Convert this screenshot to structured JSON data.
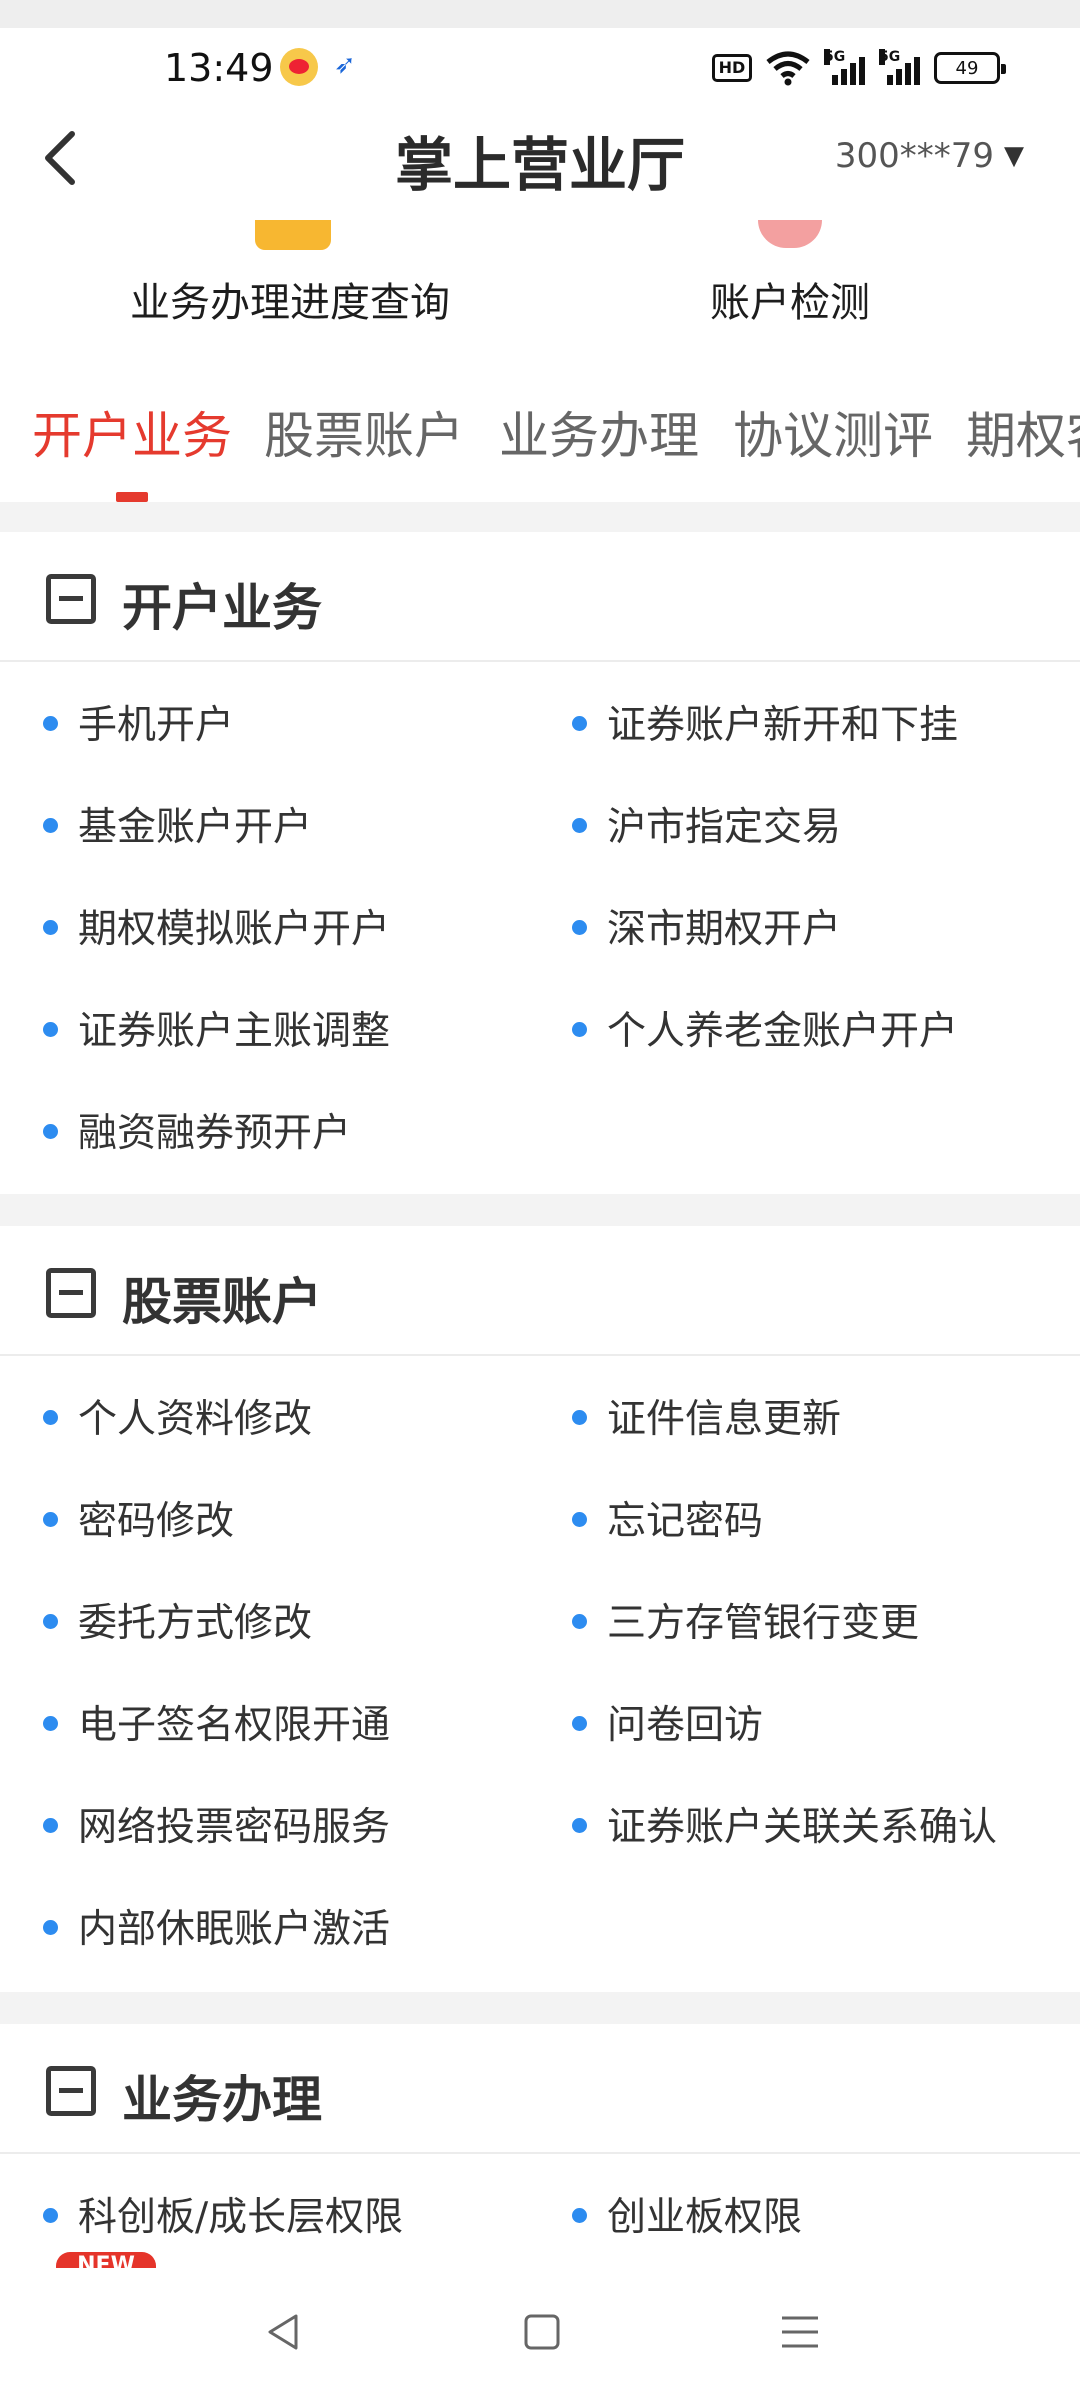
{
  "status_bar": {
    "time": "13:49",
    "hd": "HD",
    "network_1": "5G",
    "network_2": "5G",
    "battery": "49"
  },
  "header": {
    "title": "掌上营业厅",
    "account": "300***79"
  },
  "quick_actions": [
    {
      "label": "业务办理进度查询"
    },
    {
      "label": "账户检测"
    }
  ],
  "tabs": [
    {
      "label": "开户业务"
    },
    {
      "label": "股票账户"
    },
    {
      "label": "业务办理"
    },
    {
      "label": "协议测评"
    },
    {
      "label": "期权客"
    }
  ],
  "sections": [
    {
      "title": "开户业务",
      "items": [
        {
          "label": "手机开户"
        },
        {
          "label": "证券账户新开和下挂"
        },
        {
          "label": "基金账户开户"
        },
        {
          "label": "沪市指定交易"
        },
        {
          "label": "期权模拟账户开户"
        },
        {
          "label": "深市期权开户"
        },
        {
          "label": "证券账户主账调整"
        },
        {
          "label": "个人养老金账户开户"
        },
        {
          "label": "融资融券预开户"
        }
      ]
    },
    {
      "title": "股票账户",
      "items": [
        {
          "label": "个人资料修改"
        },
        {
          "label": "证件信息更新"
        },
        {
          "label": "密码修改"
        },
        {
          "label": "忘记密码"
        },
        {
          "label": "委托方式修改"
        },
        {
          "label": "三方存管银行变更"
        },
        {
          "label": "电子签名权限开通"
        },
        {
          "label": "问卷回访"
        },
        {
          "label": "网络投票密码服务"
        },
        {
          "label": "证券账户关联关系确认"
        },
        {
          "label": "内部休眠账户激活"
        }
      ]
    },
    {
      "title": "业务办理",
      "items": [
        {
          "label": "科创板/成长层权限"
        },
        {
          "label": "创业板权限"
        }
      ],
      "badge": "NEW"
    }
  ],
  "icons": {
    "back": "back-arrow-icon",
    "dropdown": "caret-down-icon",
    "collapse": "collapse-minus-icon",
    "nav_back": "nav-back-icon",
    "nav_home": "nav-home-icon",
    "nav_menu": "nav-menu-icon"
  },
  "colors": {
    "accent": "#e53a2e",
    "bullet": "#2d8cf0",
    "divider": "#f3f3f3"
  }
}
